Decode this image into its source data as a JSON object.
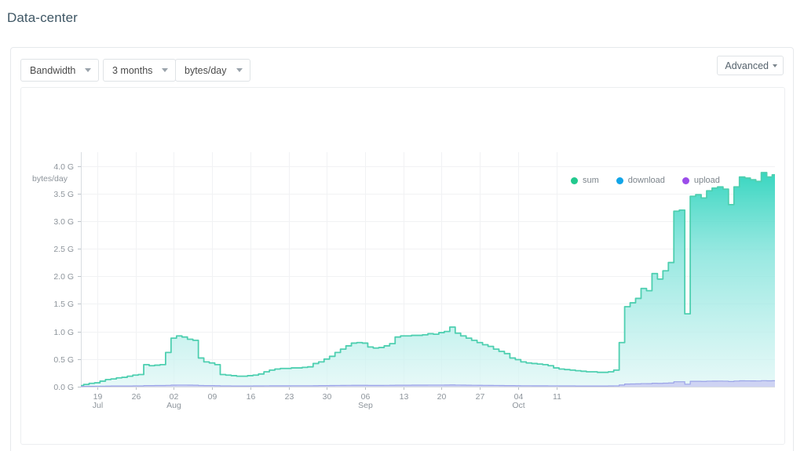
{
  "page": {
    "title": "Data-center",
    "title_color": "#3f5765"
  },
  "toolbar": {
    "metric_dropdown": {
      "label": "Bandwidth",
      "icon": "chevron-down-icon"
    },
    "range_dropdown": {
      "label": "3 months",
      "icon": "chevron-down-icon"
    },
    "unit_dropdown": {
      "label": "bytes/day",
      "icon": "chevron-down-icon"
    },
    "advanced_dropdown": {
      "label": "Advanced",
      "icon": "chevron-down-icon"
    }
  },
  "chart_data": {
    "type": "area",
    "title": "",
    "subtitle": "",
    "xlabel": "",
    "ylabel": "bytes/day",
    "ylim": [
      0,
      4.25
    ],
    "yticks": [
      0,
      0.5,
      1.0,
      1.5,
      2.0,
      2.5,
      3.0,
      3.5,
      4.0
    ],
    "ytick_labels": [
      "0.0 G",
      "0.5 G",
      "1.0 G",
      "1.5 G",
      "2.0 G",
      "2.5 G",
      "3.0 G",
      "3.5 G",
      "4.0 G"
    ],
    "grid": true,
    "legend_position": "top-right",
    "stacked": true,
    "x_unit": "days",
    "x_start": "2021-07-16",
    "x_end": "2021-10-16",
    "xticks": [
      {
        "x": 3,
        "label": "19",
        "sublabel": "Jul"
      },
      {
        "x": 10,
        "label": "26",
        "sublabel": ""
      },
      {
        "x": 17,
        "label": "02",
        "sublabel": "Aug"
      },
      {
        "x": 24,
        "label": "09",
        "sublabel": ""
      },
      {
        "x": 31,
        "label": "16",
        "sublabel": ""
      },
      {
        "x": 38,
        "label": "23",
        "sublabel": ""
      },
      {
        "x": 45,
        "label": "30",
        "sublabel": ""
      },
      {
        "x": 52,
        "label": "06",
        "sublabel": "Sep"
      },
      {
        "x": 59,
        "label": "13",
        "sublabel": ""
      },
      {
        "x": 66,
        "label": "20",
        "sublabel": ""
      },
      {
        "x": 73,
        "label": "27",
        "sublabel": ""
      },
      {
        "x": 80,
        "label": "04",
        "sublabel": "Oct"
      },
      {
        "x": 87,
        "label": "11",
        "sublabel": ""
      }
    ],
    "legend": [
      {
        "name": "sum",
        "color": "#22c98e"
      },
      {
        "name": "download",
        "color": "#12a5e8"
      },
      {
        "name": "upload",
        "color": "#9b4dea"
      }
    ],
    "series": [
      {
        "name": "sum",
        "color": "#4ecfb0",
        "fill_top": "#2fd4bd",
        "fill_bottom": "#ddf6f5",
        "values": [
          0.02,
          0.04,
          0.06,
          0.07,
          0.1,
          0.13,
          0.14,
          0.16,
          0.17,
          0.19,
          0.21,
          0.22,
          0.4,
          0.38,
          0.39,
          0.4,
          0.62,
          0.88,
          0.92,
          0.9,
          0.86,
          0.84,
          0.52,
          0.45,
          0.43,
          0.4,
          0.22,
          0.21,
          0.2,
          0.19,
          0.19,
          0.2,
          0.21,
          0.23,
          0.27,
          0.3,
          0.32,
          0.33,
          0.33,
          0.34,
          0.34,
          0.35,
          0.36,
          0.42,
          0.45,
          0.5,
          0.55,
          0.62,
          0.68,
          0.74,
          0.79,
          0.8,
          0.79,
          0.72,
          0.7,
          0.71,
          0.74,
          0.78,
          0.9,
          0.92,
          0.92,
          0.93,
          0.93,
          0.94,
          0.96,
          0.95,
          0.98,
          1.0,
          1.08,
          0.97,
          0.92,
          0.88,
          0.84,
          0.8,
          0.76,
          0.73,
          0.68,
          0.64,
          0.6,
          0.52,
          0.49,
          0.45,
          0.43,
          0.42,
          0.41,
          0.4,
          0.38,
          0.34,
          0.32,
          0.31,
          0.3,
          0.29,
          0.28,
          0.27,
          0.27,
          0.26,
          0.26,
          0.27,
          0.3,
          0.8,
          1.45,
          1.52,
          1.6,
          1.78,
          1.74,
          2.05,
          1.95,
          2.1,
          2.25,
          3.18,
          3.2,
          1.32,
          3.45,
          3.48,
          3.42,
          3.55,
          3.6,
          3.62,
          3.58,
          3.3,
          3.62,
          3.8,
          3.78,
          3.75,
          3.72,
          3.88,
          3.8,
          3.84
        ]
      },
      {
        "name": "upload",
        "color": "#9ba3e8",
        "fill": "#c9cdf2",
        "values": [
          0.005,
          0.006,
          0.007,
          0.008,
          0.01,
          0.011,
          0.012,
          0.012,
          0.013,
          0.013,
          0.014,
          0.014,
          0.02,
          0.02,
          0.021,
          0.021,
          0.024,
          0.028,
          0.029,
          0.029,
          0.028,
          0.027,
          0.021,
          0.02,
          0.019,
          0.018,
          0.014,
          0.014,
          0.013,
          0.013,
          0.013,
          0.013,
          0.014,
          0.014,
          0.015,
          0.016,
          0.016,
          0.016,
          0.016,
          0.017,
          0.017,
          0.017,
          0.017,
          0.018,
          0.019,
          0.02,
          0.021,
          0.022,
          0.023,
          0.024,
          0.025,
          0.025,
          0.025,
          0.023,
          0.023,
          0.023,
          0.024,
          0.025,
          0.027,
          0.027,
          0.027,
          0.028,
          0.028,
          0.028,
          0.029,
          0.029,
          0.029,
          0.03,
          0.032,
          0.029,
          0.028,
          0.027,
          0.026,
          0.025,
          0.024,
          0.023,
          0.022,
          0.021,
          0.02,
          0.019,
          0.018,
          0.017,
          0.017,
          0.016,
          0.016,
          0.016,
          0.015,
          0.015,
          0.014,
          0.014,
          0.014,
          0.013,
          0.013,
          0.013,
          0.013,
          0.013,
          0.013,
          0.014,
          0.015,
          0.03,
          0.048,
          0.05,
          0.052,
          0.056,
          0.055,
          0.062,
          0.06,
          0.064,
          0.068,
          0.09,
          0.09,
          0.045,
          0.098,
          0.098,
          0.096,
          0.1,
          0.101,
          0.102,
          0.1,
          0.094,
          0.102,
          0.107,
          0.106,
          0.105,
          0.104,
          0.109,
          0.107,
          0.108
        ]
      },
      {
        "name": "download",
        "color": "#12a5e8",
        "values": []
      }
    ]
  }
}
